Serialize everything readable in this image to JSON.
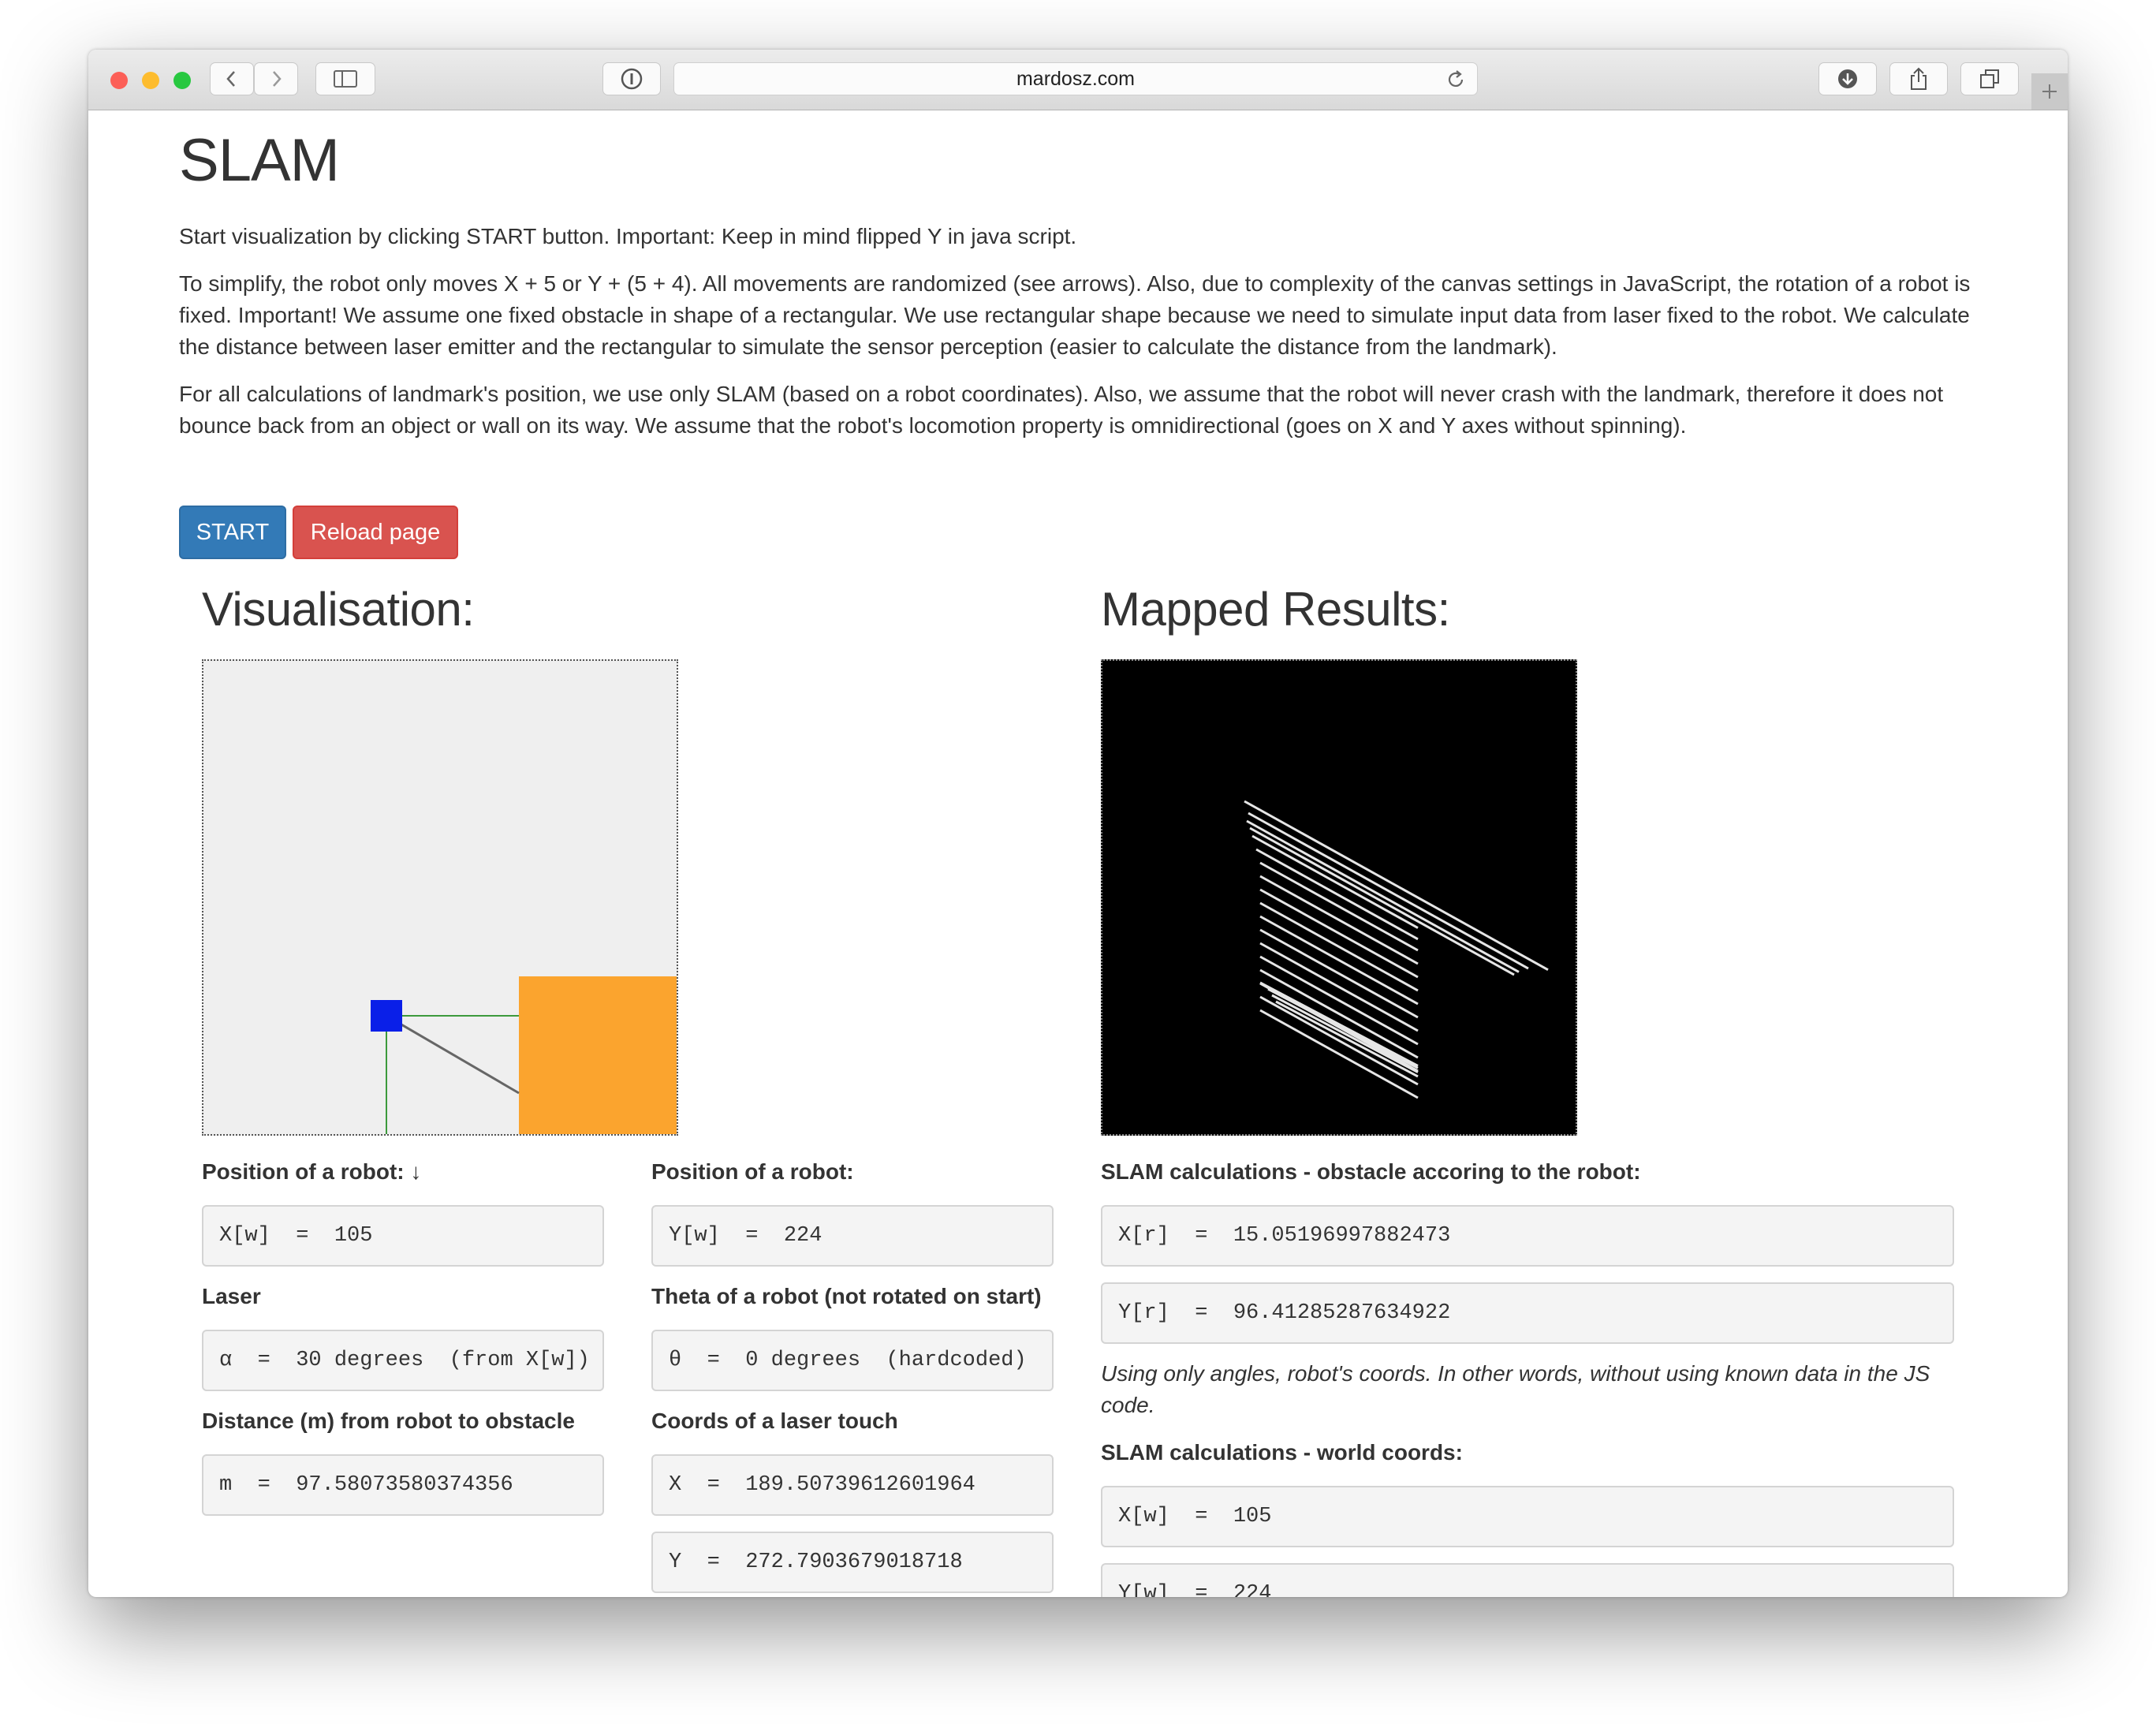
{
  "browser": {
    "url": "mardosz.com"
  },
  "page": {
    "title": "SLAM",
    "intro": "Start visualization by clicking START button. Important: Keep in mind flipped Y in java script.",
    "paragraph2": "To simplify, the robot only moves X + 5 or Y + (5 + 4). All movements are randomized (see arrows). Also, due to complexity of the canvas settings in JavaScript, the rotation of a robot is fixed. Important! We assume one fixed obstacle in shape of a rectangular. We use rectangular shape because we need to simulate input data from laser fixed to the robot. We calculate the distance between laser emitter and the rectangular to simulate the sensor perception (easier to calculate the distance from the landmark).",
    "paragraph3": "For all calculations of landmark's position, we use only SLAM (based on a robot coordinates). Also, we assume that the robot will never crash with the landmark, therefore it does not bounce back from an object or wall on its way. We assume that the robot's locomotion property is omnidirectional (goes on X and Y axes without spinning).",
    "start_label": "START",
    "reload_label": "Reload page",
    "visualisation_title": "Visualisation:",
    "mapped_title": "Mapped Results:"
  },
  "colors": {
    "start_button": "#337ab7",
    "reload_button": "#d9534f",
    "robot": "#0a1fe8",
    "obstacle": "#fba42e",
    "laser_line": "#3c9a3c",
    "canvas_bg": "#efefef",
    "mapped_bg": "#000000"
  },
  "panels": {
    "position_x": {
      "label": "Position of a robot: ↓",
      "value": "X[w]  =  105"
    },
    "position_y": {
      "label": "Position of a robot:",
      "value": "Y[w]  =  224"
    },
    "laser": {
      "label": "Laser",
      "value": "α  =  30 degrees  (from X[w])"
    },
    "theta": {
      "label": "Theta of a robot (not rotated on start)",
      "value": "θ  =  0 degrees  (hardcoded)"
    },
    "distance": {
      "label": "Distance (m) from robot to obstacle",
      "value": "m  =  97.58073580374356"
    },
    "laser_touch": {
      "label": "Coords of a laser touch",
      "x_value": "X  =  189.50739612601964",
      "y_value": "Y  =  272.7903679018718"
    },
    "slam_robot": {
      "label": "SLAM calculations - obstacle accoring to the robot:",
      "x_value": "X[r]  =  15.05196997882473",
      "y_value": "Y[r]  =  96.41285287634922"
    },
    "slam_note": "Using only angles, robot's coords. In other words, without using known data in the JS code.",
    "slam_world": {
      "label": "SLAM calculations - world coords:",
      "x_value": "X[w]  =  105",
      "y_value": "Y[w]  =  224"
    }
  }
}
